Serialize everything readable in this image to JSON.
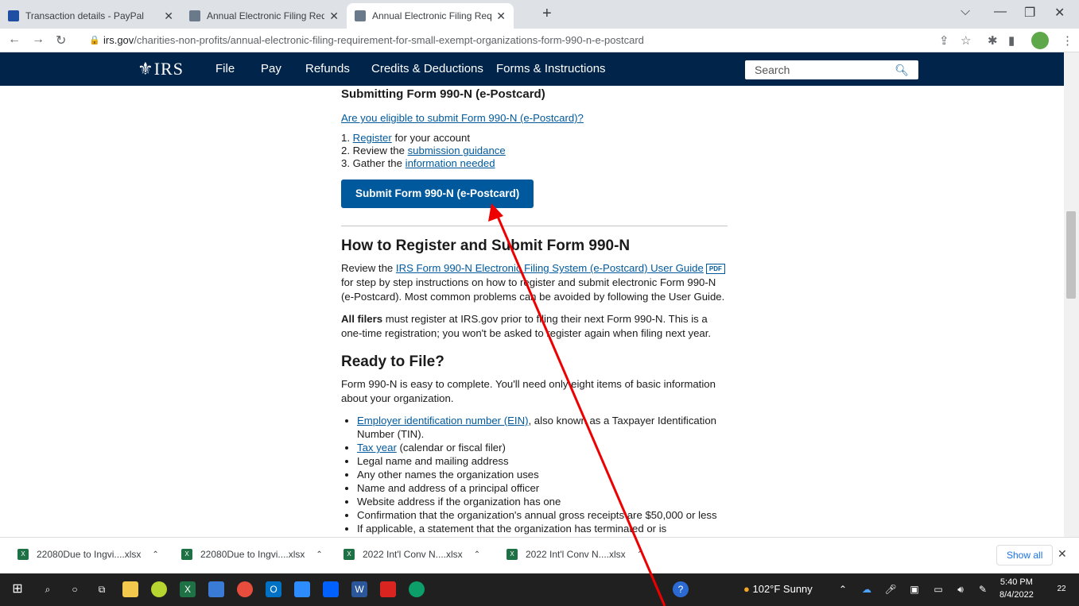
{
  "browser": {
    "tabs": [
      {
        "title": "Transaction details - PayPal"
      },
      {
        "title": "Annual Electronic Filing Requirem"
      },
      {
        "title": "Annual Electronic Filing Requirem"
      }
    ],
    "url_host": "irs.gov",
    "url_path": "/charities-non-profits/annual-electronic-filing-requirement-for-small-exempt-organizations-form-990-n-e-postcard"
  },
  "irs_nav": {
    "logo": "IRS",
    "links": [
      "File",
      "Pay",
      "Refunds",
      "Credits & Deductions",
      "Forms & Instructions"
    ],
    "search_placeholder": "Search"
  },
  "content": {
    "submitting_heading": "Submitting Form 990-N (e-Postcard)",
    "eligible_link": "Are you eligible to submit Form 990-N (e-Postcard)?",
    "steps": [
      {
        "num": "1. ",
        "link": "Register",
        "rest": " for your account"
      },
      {
        "num": "2. Review the ",
        "link": "submission guidance",
        "rest": ""
      },
      {
        "num": "3. Gather the ",
        "link": "information needed",
        "rest": ""
      }
    ],
    "submit_button": "Submit Form 990-N (e-Postcard)",
    "register_heading": "How to Register and Submit Form 990-N",
    "review_prefix": "Review the ",
    "review_link": "IRS Form 990-N Electronic Filing System (e-Postcard) User Guide",
    "pdf_badge": "PDF",
    "review_suffix": " for step by step instructions on how to register and submit electronic Form 990-N (e-Postcard). Most common problems can be avoided by following the User Guide.",
    "all_filers_bold": "All filers",
    "all_filers_rest": " must register at IRS.gov prior to filing their next Form 990-N. This is a one-time registration; you won't be asked to register again when filing next year.",
    "ready_heading": "Ready to File?",
    "ready_text": "Form 990-N is easy to complete. You'll need only eight items of basic information about your organization.",
    "bullets": [
      {
        "link": "Employer identification number (EIN)",
        "text": ", also known as a Taxpayer Identification Number (TIN)."
      },
      {
        "link": "Tax year",
        "text": " (calendar or fiscal filer)"
      },
      {
        "link": "",
        "text": "Legal name and mailing address"
      },
      {
        "link": "",
        "text": "Any other names the organization uses"
      },
      {
        "link": "",
        "text": "Name and address of a principal officer"
      },
      {
        "link": "",
        "text": "Website address if the organization has one"
      },
      {
        "link": "",
        "text": "Confirmation that the organization's annual gross receipts are $50,000 or less"
      },
      {
        "link": "",
        "text": "If applicable, a statement that the organization has terminated or is"
      }
    ]
  },
  "downloads": {
    "items": [
      "22080Due to Ingvi....xlsx",
      "22080Due to Ingvi....xlsx",
      "2022 Int'l Conv N....xlsx",
      "2022 Int'l Conv N....xlsx"
    ],
    "show_all": "Show all"
  },
  "taskbar": {
    "weather": "102°F  Sunny",
    "time": "5:40 PM",
    "date": "8/4/2022",
    "notifications": "22"
  },
  "colors": {
    "irs_navy": "#00244a",
    "link_blue": "#00599c",
    "annotation_arrow": "#ee0000"
  }
}
